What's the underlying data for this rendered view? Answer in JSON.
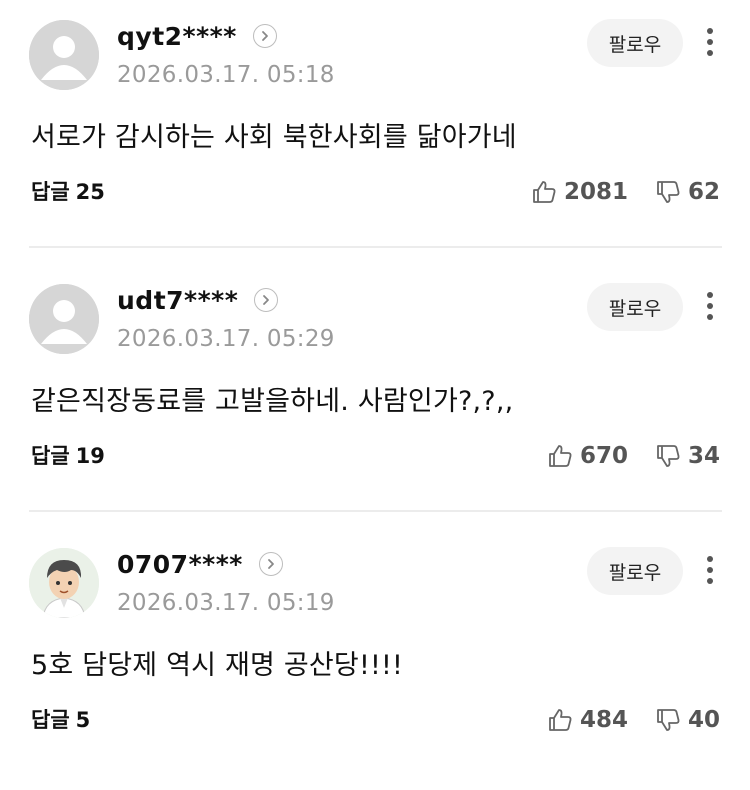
{
  "colors": {
    "text": "#111111",
    "muted": "#9a9a9a",
    "follow_bg": "#f3f3f3",
    "icon": "#555555"
  },
  "comments": [
    {
      "username": "qyt2****",
      "timestamp": "2026.03.17. 05:18",
      "follow_label": "팔로우",
      "text": "서로가 감시하는 사회 북한사회를 닮아가네",
      "reply_label": "답글",
      "reply_count": "25",
      "likes": "2081",
      "dislikes": "62",
      "avatar": "default-avatar"
    },
    {
      "username": "udt7****",
      "timestamp": "2026.03.17. 05:29",
      "follow_label": "팔로우",
      "text": "같은직장동료를 고발을하네. 사람인가?,?,,",
      "reply_label": "답글",
      "reply_count": "19",
      "likes": "670",
      "dislikes": "34",
      "avatar": "default-avatar"
    },
    {
      "username": "0707****",
      "timestamp": "2026.03.17. 05:19",
      "follow_label": "팔로우",
      "text": "5호 담당제 역시 재명 공산당!!!!",
      "reply_label": "답글",
      "reply_count": "5",
      "likes": "484",
      "dislikes": "40",
      "avatar": "character-avatar"
    }
  ]
}
